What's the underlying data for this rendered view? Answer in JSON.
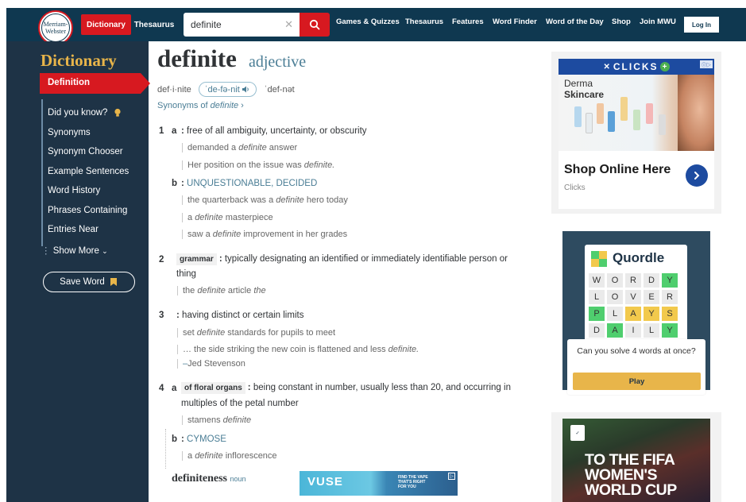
{
  "header": {
    "logo_line1": "Merriam-",
    "logo_line2": "Webster",
    "tab_dictionary": "Dictionary",
    "tab_thesaurus": "Thesaurus",
    "search_value": "definite",
    "nav": [
      "Games & Quizzes",
      "Thesaurus",
      "Features",
      "Word Finder",
      "Word of the Day",
      "Shop",
      "Join MWU"
    ],
    "login_label": "Log In"
  },
  "sidebar": {
    "title": "Dictionary",
    "active_item": "Definition",
    "items": [
      "Did you know?",
      "Synonyms",
      "Synonym Chooser",
      "Example Sentences",
      "Word History",
      "Phrases Containing",
      "Entries Near"
    ],
    "show_more": "Show More",
    "save_word": "Save Word"
  },
  "entry": {
    "headword": "definite",
    "part_of_speech": "adjective",
    "syllables": "def·i·nite",
    "pronunciation": "ˈde-fə-nit",
    "pronunciation_alt": "ˈdef-nət",
    "synonyms_prefix": "Synonyms of ",
    "synonyms_word": "definite",
    "synonyms_suffix": " ›",
    "senses": {
      "s1_num": "1",
      "s1a_letter": "a",
      "s1a_def": "free of all ambiguity, uncertainty, or obscurity",
      "s1a_ex1_pre": "demanded a ",
      "s1a_ex1_word": "definite",
      "s1a_ex1_post": " answer",
      "s1a_ex2_pre": "Her position on the issue was ",
      "s1a_ex2_word": "definite.",
      "s1b_letter": "b",
      "s1b_xref": "UNQUESTIONABLE, DECIDED",
      "s1b_ex1_pre": "the quarterback was a ",
      "s1b_ex1_word": "definite",
      "s1b_ex1_post": " hero today",
      "s1b_ex2_pre": "a ",
      "s1b_ex2_word": "definite",
      "s1b_ex2_post": " masterpiece",
      "s1b_ex3_pre": "saw a ",
      "s1b_ex3_word": "definite",
      "s1b_ex3_post": " improvement in her grades",
      "s2_num": "2",
      "s2_label": "grammar",
      "s2_def_line1": "typically designating an identified or immediately identifiable person or",
      "s2_def_line2": "thing",
      "s2_ex1_pre": "the ",
      "s2_ex1_word": "definite",
      "s2_ex1_mid": " article ",
      "s2_ex1_word2": "the",
      "s3_num": "3",
      "s3_def": "having distinct or certain limits",
      "s3_ex1_pre": "set ",
      "s3_ex1_word": "definite",
      "s3_ex1_post": " standards for pupils to meet",
      "s3_ex2_pre": "… the side striking the new coin is flattened and less ",
      "s3_ex2_word": "definite.",
      "s3_credit_dash": "–",
      "s3_credit": "Jed Stevenson",
      "s4_num": "4",
      "s4a_letter": "a",
      "s4_label": "of floral organs",
      "s4_def_line1": "being constant in number, usually less than 20, and occurring in",
      "s4_def_line2": "multiples of the petal number",
      "s4_ex1_pre": "stamens ",
      "s4_ex1_word": "definite",
      "s4b_letter": "b",
      "s4b_xref": "CYMOSE",
      "s4b_ex1_pre": "a ",
      "s4b_ex1_word": "definite",
      "s4b_ex1_post": " inflorescence"
    },
    "runon_word": "definiteness",
    "runon_pos": "noun"
  },
  "ads": {
    "clicks_brand": "CLICKS",
    "clicks_derma": "Derma",
    "clicks_skincare": "Skincare",
    "clicks_title": "Shop Online Here",
    "clicks_sub": "Clicks",
    "quordle_title": "Quordle",
    "quordle_grid": [
      [
        "W",
        "O",
        "R",
        "D",
        "Y"
      ],
      [
        "L",
        "O",
        "V",
        "E",
        "R"
      ],
      [
        "P",
        "L",
        "A",
        "Y",
        "S"
      ],
      [
        "D",
        "A",
        "I",
        "L",
        "Y"
      ]
    ],
    "quordle_question": "Can you solve 4 words at once?",
    "quordle_play": "Play",
    "vuse_brand": "VUSE",
    "vuse_tagline_1": "FIND THE VAPE",
    "vuse_tagline_2": "THAT'S RIGHT",
    "vuse_tagline_3": "FOR YOU",
    "fifa_line1": "TO THE FIFA",
    "fifa_line2": "WOMEN'S",
    "fifa_line3": "WORLD CUP"
  },
  "colors": {
    "brand_navy": "#0f3850",
    "brand_red": "#d71920",
    "sidebar_bg": "#1e3346",
    "accent_gold": "#e8b54a",
    "link_blue": "#4a7d95"
  }
}
